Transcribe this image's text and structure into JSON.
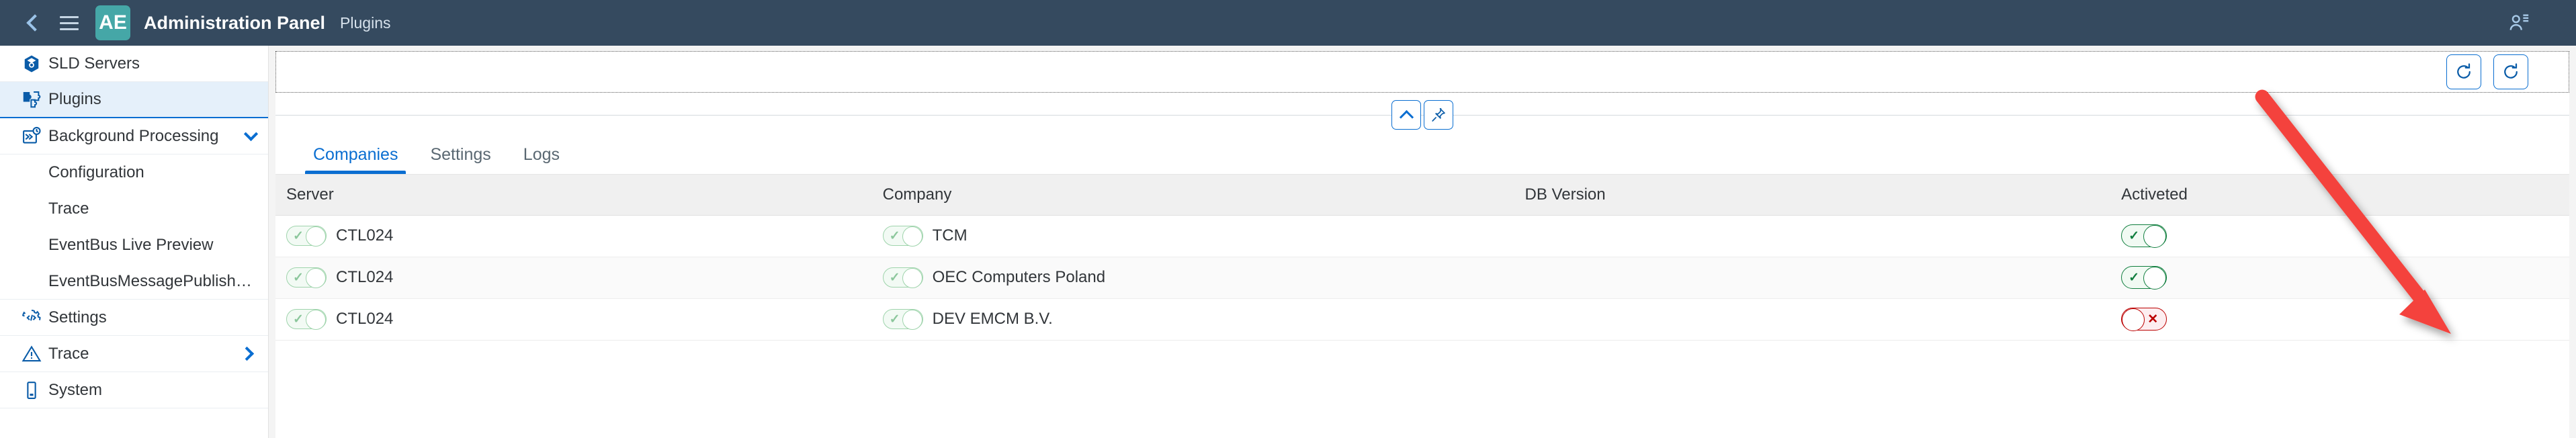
{
  "topbar": {
    "back_icon": "chevron-left-icon",
    "menu_icon": "hamburger-menu-icon",
    "logo_text": "AE",
    "title": "Administration Panel",
    "subtitle": "Plugins",
    "user_icon": "user-settings-icon"
  },
  "sidebar": {
    "items": [
      {
        "label": "SLD Servers",
        "icon": "cube-icon",
        "selected": false,
        "sub": false,
        "arrow": ""
      },
      {
        "label": "Plugins",
        "icon": "puzzle-piece-icon",
        "selected": true,
        "sub": false,
        "arrow": ""
      },
      {
        "label": "Background Processing",
        "icon": "background-tasks-icon",
        "selected": false,
        "sub": false,
        "arrow": "chevron-down-icon"
      },
      {
        "label": "Configuration",
        "icon": "",
        "selected": false,
        "sub": true,
        "arrow": ""
      },
      {
        "label": "Trace",
        "icon": "",
        "selected": false,
        "sub": true,
        "arrow": ""
      },
      {
        "label": "EventBus Live Preview",
        "icon": "",
        "selected": false,
        "sub": true,
        "arrow": ""
      },
      {
        "label": "EventBusMessagePublisher...",
        "icon": "",
        "selected": false,
        "sub": true,
        "arrow": ""
      },
      {
        "label": "Settings",
        "icon": "settings-code-icon",
        "selected": false,
        "sub": false,
        "arrow": ""
      },
      {
        "label": "Trace",
        "icon": "warning-triangle-icon",
        "selected": false,
        "sub": false,
        "arrow": "chevron-right-icon"
      },
      {
        "label": "System",
        "icon": "device-icon",
        "selected": false,
        "sub": false,
        "arrow": ""
      }
    ]
  },
  "toolbar": {
    "refresh_label": "refresh-icon",
    "reload_label": "reload-icon"
  },
  "splitter": {
    "collapse_icon": "chevron-up-icon",
    "pin_icon": "pin-icon"
  },
  "tabs": [
    {
      "label": "Companies",
      "active": true
    },
    {
      "label": "Settings",
      "active": false
    },
    {
      "label": "Logs",
      "active": false
    }
  ],
  "table": {
    "headers": [
      "Server",
      "Company",
      "DB Version",
      "Activeted"
    ],
    "rows": [
      {
        "server": "CTL024",
        "server_switch": "on",
        "company": "TCM",
        "company_switch": "on",
        "db_version": "",
        "activated": "on",
        "activated_mark": "✓"
      },
      {
        "server": "CTL024",
        "server_switch": "on",
        "company": "OEC Computers Poland",
        "company_switch": "on",
        "db_version": "",
        "activated": "on",
        "activated_mark": "✓"
      },
      {
        "server": "CTL024",
        "server_switch": "on",
        "company": "DEV EMCM B.V.",
        "company_switch": "on",
        "db_version": "",
        "activated": "off",
        "activated_mark": "✕"
      }
    ],
    "check_mark": "✓",
    "cross_mark": "✕"
  },
  "annotation": {
    "arrow_color": "#f4433c",
    "type": "red-arrow-pointing-to-activated-toggle"
  },
  "colors": {
    "topbar_bg": "#354a5f",
    "accent": "#0a6ed1",
    "logo_bg": "#45a7a7",
    "success": "#107e3e",
    "danger": "#bb0000"
  }
}
